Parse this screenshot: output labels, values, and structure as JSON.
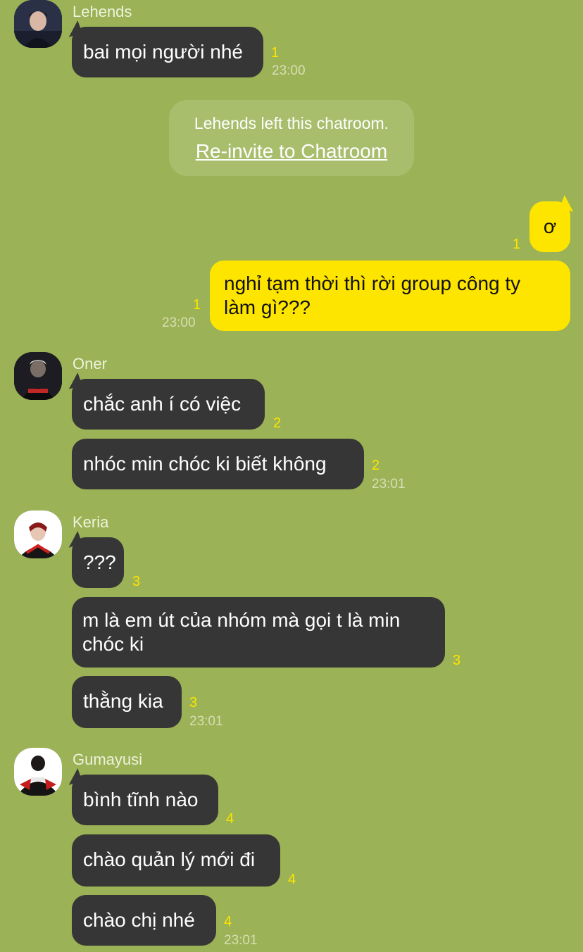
{
  "messages": {
    "lehends": {
      "name": "Lehends",
      "m1": "bai mọi người nhé",
      "m1_unread": "1",
      "m1_time": "23:00"
    },
    "notice": {
      "text": "Lehends left this chatroom.",
      "link": "Re-invite to Chatroom"
    },
    "me": {
      "m1": "ơ",
      "m1_unread": "1",
      "m2": "nghỉ tạm thời thì rời group công ty làm gì???",
      "m2_unread": "1",
      "m2_time": "23:00"
    },
    "oner": {
      "name": "Oner",
      "m1": "chắc anh í có việc",
      "m1_unread": "2",
      "m2": "nhóc min chóc ki biết không",
      "m2_unread": "2",
      "m2_time": "23:01"
    },
    "keria": {
      "name": "Keria",
      "m1": "???",
      "m1_unread": "3",
      "m2": "m là em út của nhóm mà gọi t là min chóc ki",
      "m2_unread": "3",
      "m3": "thằng kia",
      "m3_unread": "3",
      "m3_time": "23:01"
    },
    "gumayusi": {
      "name": "Gumayusi",
      "m1": "bình tĩnh nào",
      "m1_unread": "4",
      "m2": "chào quản lý mới đi",
      "m2_unread": "4",
      "m3": "chào chị nhé",
      "m3_unread": "4",
      "m3_time": "23:01"
    }
  },
  "colors": {
    "background": "#9bb256",
    "bubble_other": "#363636",
    "bubble_mine": "#fee500",
    "unread_count": "#fee500"
  }
}
